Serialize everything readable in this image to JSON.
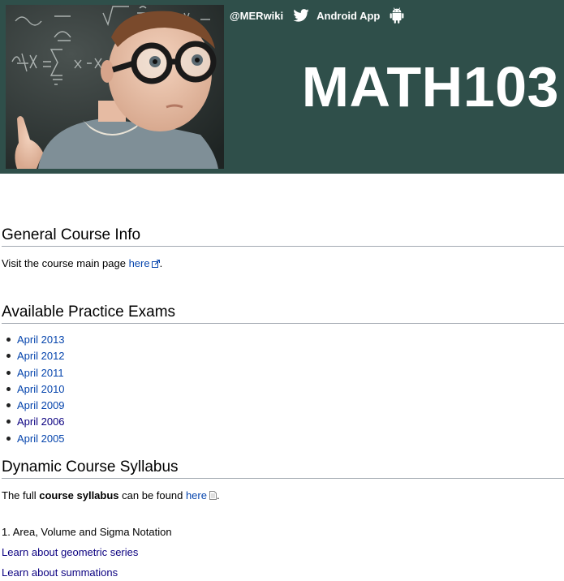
{
  "header": {
    "twitter_handle": "@MERwiki",
    "android_label": "Android App",
    "course_code": "MATH103",
    "colors": {
      "banner": "#2f4f4a",
      "text": "#ffffff"
    },
    "icons": {
      "twitter": "twitter-icon",
      "android": "android-icon"
    }
  },
  "general": {
    "heading": "General Course Info",
    "text_before": "Visit the course main page ",
    "link": "here",
    "text_after": "."
  },
  "exams": {
    "heading": "Available Practice Exams",
    "items": [
      "April 2013",
      "April 2012",
      "April 2011",
      "April 2010",
      "April 2009",
      "April 2006",
      "April 2005"
    ]
  },
  "syllabus": {
    "heading": "Dynamic Course Syllabus",
    "text_before": "The full ",
    "bold": "course syllabus",
    "text_middle": " can be found ",
    "link": "here",
    "text_after": ".",
    "topic": "1. Area, Volume and Sigma Notation",
    "links": [
      "Learn about geometric series",
      "Learn about summations"
    ]
  },
  "colors": {
    "link": "#0645ad",
    "visited_link": "#0b0080",
    "rule": "#a2a9b1"
  }
}
